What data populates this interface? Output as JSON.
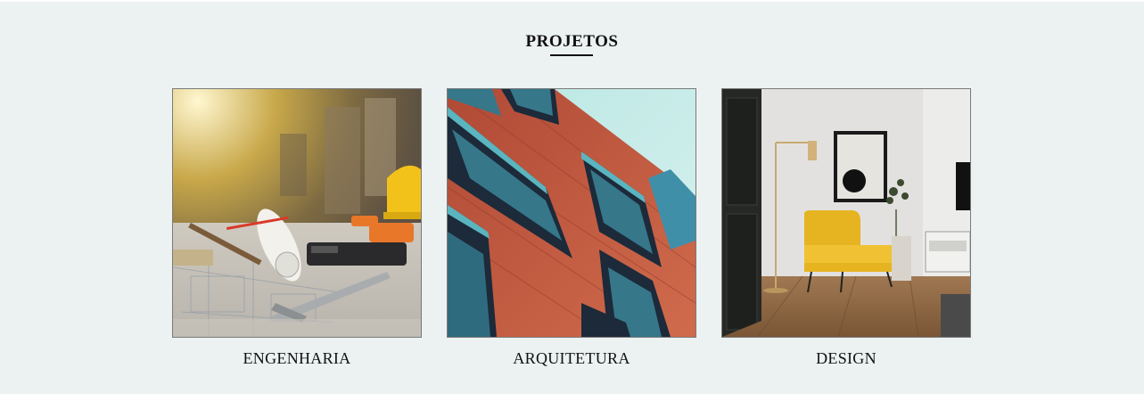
{
  "section": {
    "title": "PROJETOS",
    "background_color": "#ecf1f1"
  },
  "projects": [
    {
      "label": "ENGENHARIA",
      "image_subject": "blueprints, tools and hard hat on construction site"
    },
    {
      "label": "ARQUITETURA",
      "image_subject": "modern building facade with red cladding and teal balconies"
    },
    {
      "label": "DESIGN",
      "image_subject": "living room with yellow armchair, floor lamp and framed art"
    }
  ]
}
